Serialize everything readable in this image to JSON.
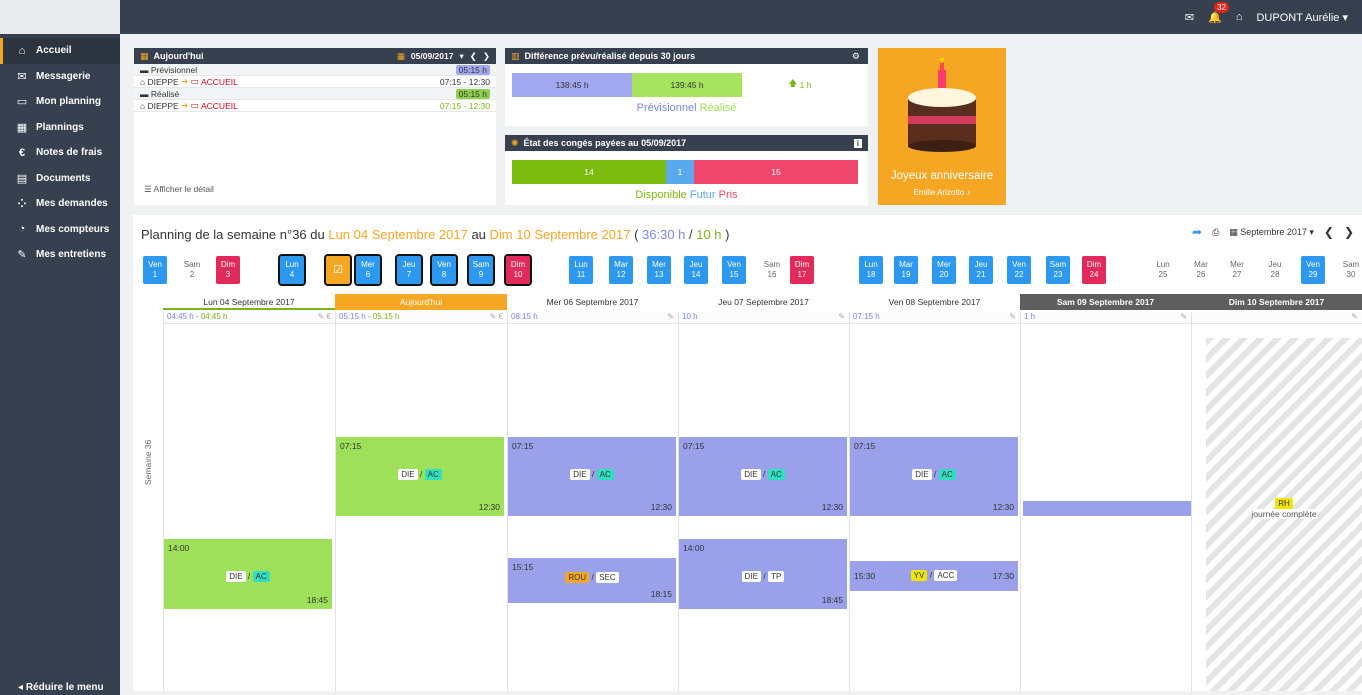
{
  "topbar": {
    "user": "DUPONT Aurélie",
    "notif_count": "32"
  },
  "sidebar": {
    "items": [
      {
        "label": "Accueil",
        "icon": "home-icon"
      },
      {
        "label": "Messagerie",
        "icon": "envelope-icon"
      },
      {
        "label": "Mon planning",
        "icon": "calendar-icon"
      },
      {
        "label": "Plannings",
        "icon": "calendar-grid-icon"
      },
      {
        "label": "Notes de frais",
        "icon": "euro-icon"
      },
      {
        "label": "Documents",
        "icon": "document-icon"
      },
      {
        "label": "Mes demandes",
        "icon": "spinner-icon"
      },
      {
        "label": "Mes compteurs",
        "icon": "gauge-icon"
      },
      {
        "label": "Mes entretiens",
        "icon": "edit-icon"
      }
    ],
    "reduce": "Réduire le menu"
  },
  "today": {
    "title": "Aujourd'hui",
    "date": "05/09/2017",
    "prev_label": "Prévisionnel",
    "prev_total": "05:15 h",
    "prev_from": "DIEPPE",
    "prev_to": "ACCUEIL",
    "prev_time": "07:15 - 12:30",
    "real_label": "Réalisé",
    "real_total": "05:15 h",
    "real_from": "DIEPPE",
    "real_to": "ACCUEIL",
    "real_time": "07:15 - 12:30",
    "detail": "Afficher le détail"
  },
  "diff": {
    "title": "Différence prévu/réalisé depuis 30 jours",
    "prev": "138:45 h",
    "real": "139:45 h",
    "delta": "1 h",
    "leg_prev": "Prévisionnel",
    "leg_real": "Réalisé"
  },
  "conges": {
    "title": "État des congés payées au 05/09/2017",
    "dispo": "14",
    "futur": "1",
    "pris": "15",
    "leg_dispo": "Disponible",
    "leg_futur": "Futur",
    "leg_pris": "Pris"
  },
  "bday": {
    "title": "Joyeux anniversaire",
    "name": "Emilie Arizotto"
  },
  "planning": {
    "t1": "Planning de la semaine n°36 du ",
    "t2": "Lun 04 Septembre 2017",
    "t3": " au ",
    "t4": "Dim 10 Septembre 2017",
    "t5": " ( ",
    "t6": "36:30 h",
    "t7": " / ",
    "t8": "10 h",
    "t9": " )",
    "month": "Septembre 2017",
    "week": "Semaine 36"
  },
  "days": [
    [
      "Ven",
      "1"
    ],
    [
      "Sam",
      "2"
    ],
    [
      "Dim",
      "3"
    ],
    [
      "Lun",
      "4"
    ],
    [
      "",
      ""
    ],
    [
      "Mer",
      "6"
    ],
    [
      "Jeu",
      "7"
    ],
    [
      "Ven",
      "8"
    ],
    [
      "Sam",
      "9"
    ],
    [
      "Dim",
      "10"
    ],
    [
      "Lun",
      "11"
    ],
    [
      "Mar",
      "12"
    ],
    [
      "Mer",
      "13"
    ],
    [
      "Jeu",
      "14"
    ],
    [
      "Ven",
      "15"
    ],
    [
      "Sam",
      "16"
    ],
    [
      "Dim",
      "17"
    ],
    [
      "Lun",
      "18"
    ],
    [
      "Mar",
      "19"
    ],
    [
      "Mer",
      "20"
    ],
    [
      "Jeu",
      "21"
    ],
    [
      "Ven",
      "22"
    ],
    [
      "Sam",
      "23"
    ],
    [
      "Dim",
      "24"
    ],
    [
      "Lun",
      "25"
    ],
    [
      "Mar",
      "26"
    ],
    [
      "Mer",
      "27"
    ],
    [
      "Jeu",
      "28"
    ],
    [
      "Ven",
      "29"
    ],
    [
      "Sam",
      "30"
    ]
  ],
  "cols": [
    "Lun 04 Septembre 2017",
    "Aujourd'hui",
    "Mer 06 Septembre 2017",
    "Jeu 07 Septembre 2017",
    "Ven 08 Septembre 2017",
    "Sam 09 Septembre 2017",
    "Dim 10 Septembre 2017"
  ],
  "sub": [
    {
      "a": "04:45 h",
      "b": "04:45 h"
    },
    {
      "a": "05:15 h",
      "b": "05:15 h"
    },
    {
      "a": "08:15 h",
      "b": ""
    },
    {
      "a": "10 h",
      "b": ""
    },
    {
      "a": "07:15 h",
      "b": ""
    },
    {
      "a": "1 h",
      "b": ""
    },
    {
      "a": "",
      "b": ""
    }
  ],
  "events": [
    {
      "s": "07:15",
      "e": "12:30",
      "t1": "DIE",
      "t2": "AC"
    },
    {
      "s": "14:00",
      "e": "18:45",
      "t1": "DIE",
      "t2": "AC"
    },
    {
      "s": "07:15",
      "e": "12:30",
      "t1": "DIE",
      "t2": "AC"
    },
    {
      "s": "07:15",
      "e": "12:30",
      "t1": "DIE",
      "t2": "AC"
    },
    {
      "s": "15:15",
      "e": "18:15",
      "t1": "ROU",
      "t2": "SEC"
    },
    {
      "s": "07:15",
      "e": "12:30",
      "t1": "DIE",
      "t2": "AC"
    },
    {
      "s": "14:00",
      "e": "18:45",
      "t1": "DIE",
      "t2": "TP"
    },
    {
      "s": "15:30",
      "e": "17:30",
      "t1": "YV",
      "t2": "ACC"
    }
  ],
  "rh": {
    "code": "RH",
    "label": "journée complète"
  }
}
